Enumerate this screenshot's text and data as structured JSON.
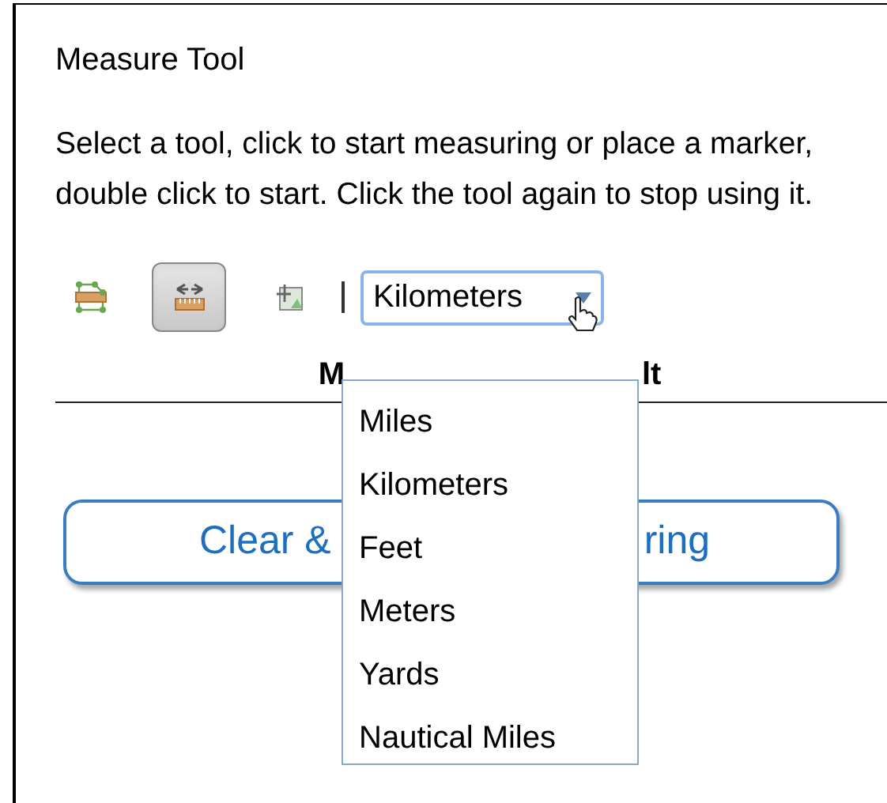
{
  "panel": {
    "title": "Measure Tool",
    "instructions": "Select a tool, click to start measuring or place a marker, double click to start. Click the tool again to stop using it.",
    "tools": [
      {
        "kind": "area",
        "selected": false
      },
      {
        "kind": "distance",
        "selected": true
      },
      {
        "kind": "location",
        "selected": false
      }
    ],
    "units": {
      "value": "Kilometers",
      "expanded": true,
      "options": [
        "Miles",
        "Kilometers",
        "Feet",
        "Meters",
        "Yards",
        "Nautical Miles"
      ]
    },
    "result_header": {
      "column_1": "M",
      "column_2": "lt"
    },
    "clear_button": {
      "text_start": "Clear &",
      "text_end": "ring"
    }
  }
}
